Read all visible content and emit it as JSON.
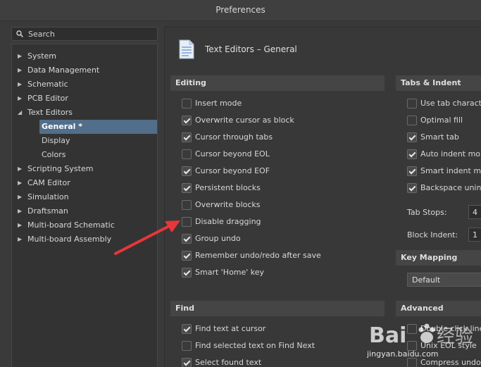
{
  "window": {
    "title": "Preferences"
  },
  "search": {
    "label": "Search"
  },
  "tree": [
    {
      "label": "System",
      "type": "collapsed"
    },
    {
      "label": "Data Management",
      "type": "collapsed"
    },
    {
      "label": "Schematic",
      "type": "collapsed"
    },
    {
      "label": "PCB Editor",
      "type": "collapsed"
    },
    {
      "label": "Text Editors",
      "type": "expanded"
    },
    {
      "label": "General *",
      "type": "selected"
    },
    {
      "label": "Display",
      "type": "child"
    },
    {
      "label": "Colors",
      "type": "child"
    },
    {
      "label": "Scripting System",
      "type": "collapsed"
    },
    {
      "label": "CAM Editor",
      "type": "collapsed"
    },
    {
      "label": "Simulation",
      "type": "collapsed"
    },
    {
      "label": "Draftsman",
      "type": "collapsed"
    },
    {
      "label": "Multi-board Schematic",
      "type": "collapsed"
    },
    {
      "label": "Multi-board Assembly",
      "type": "collapsed"
    }
  ],
  "page": {
    "title": "Text Editors – General",
    "icon": "document-icon"
  },
  "editing": {
    "header": "Editing",
    "options": [
      {
        "label": "Insert mode",
        "checked": false
      },
      {
        "label": "Overwrite cursor as block",
        "checked": true
      },
      {
        "label": "Cursor through tabs",
        "checked": true
      },
      {
        "label": "Cursor beyond EOL",
        "checked": false
      },
      {
        "label": "Cursor beyond EOF",
        "checked": true
      },
      {
        "label": "Persistent blocks",
        "checked": true
      },
      {
        "label": "Overwrite blocks",
        "checked": false
      },
      {
        "label": "Disable dragging",
        "checked": false
      },
      {
        "label": "Group undo",
        "checked": true
      },
      {
        "label": "Remember undo/redo after save",
        "checked": true
      },
      {
        "label": "Smart 'Home' key",
        "checked": true
      }
    ]
  },
  "tabs_indent": {
    "header": "Tabs & Indent",
    "options": [
      {
        "label": "Use tab characte",
        "checked": false
      },
      {
        "label": "Optimal fill",
        "checked": false
      },
      {
        "label": "Smart tab",
        "checked": true
      },
      {
        "label": "Auto indent mo",
        "checked": true
      },
      {
        "label": "Smart indent mo",
        "checked": true
      },
      {
        "label": "Backspace unind",
        "checked": true
      }
    ],
    "tab_stops_label": "Tab Stops:",
    "tab_stops_value": "4",
    "block_indent_label": "Block Indent:",
    "block_indent_value": "1"
  },
  "key_mapping": {
    "header": "Key Mapping",
    "value": "Default"
  },
  "find": {
    "header": "Find",
    "options": [
      {
        "label": "Find text at cursor",
        "checked": true
      },
      {
        "label": "Find selected text on Find Next",
        "checked": false
      },
      {
        "label": "Select found text",
        "checked": true
      }
    ]
  },
  "advanced": {
    "header": "Advanced",
    "options": [
      {
        "label": "Double click line",
        "checked": false
      },
      {
        "label": "Unix EOL style",
        "checked": false
      },
      {
        "label": "Compress undo r",
        "checked": false
      }
    ]
  },
  "watermark": {
    "text": "jingyan.baidu.com"
  },
  "colors": {
    "selection": "#516e8a",
    "annotation_arrow": "#e8363a"
  }
}
